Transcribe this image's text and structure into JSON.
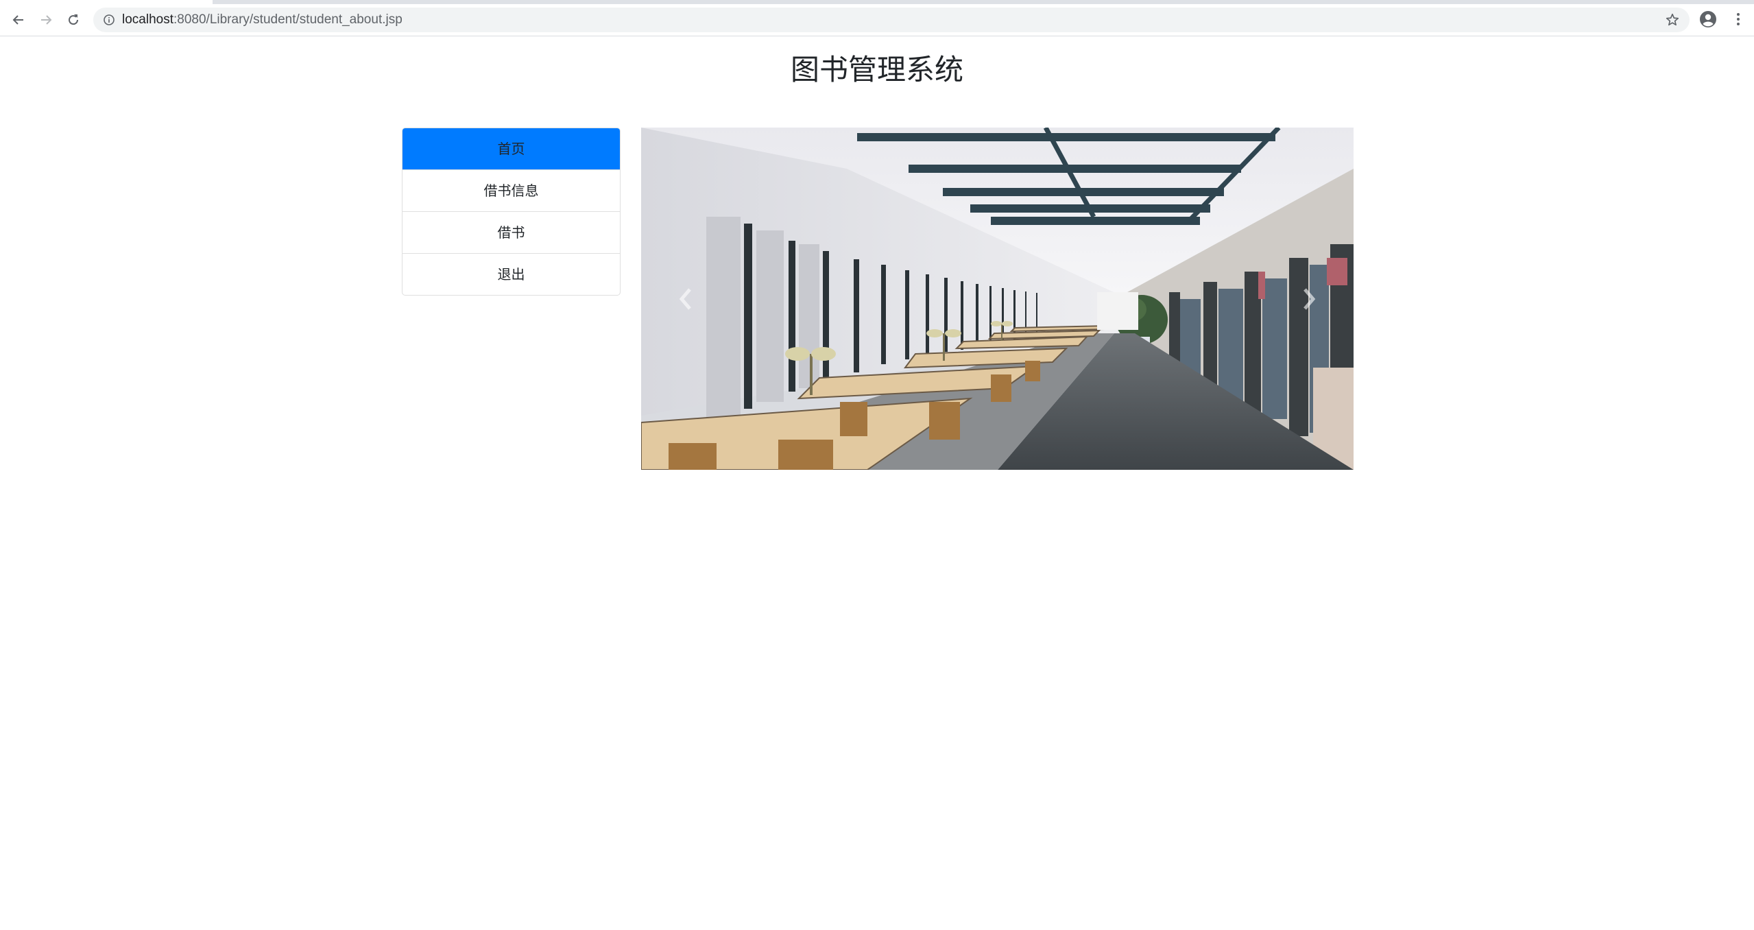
{
  "browser": {
    "url_host": "localhost",
    "url_rest": ":8080/Library/student/student_about.jsp",
    "icons": {
      "back": "back-arrow-icon",
      "forward": "forward-arrow-icon",
      "reload": "reload-icon",
      "info": "info-icon",
      "bookmark": "star-icon",
      "profile": "profile-icon",
      "menu": "kebab-menu-icon"
    }
  },
  "page": {
    "title": "图书管理系统"
  },
  "sidebar": {
    "items": [
      {
        "label": "首页",
        "active": true
      },
      {
        "label": "借书信息",
        "active": false
      },
      {
        "label": "借书",
        "active": false
      },
      {
        "label": "退出",
        "active": false
      }
    ]
  },
  "carousel": {
    "image": "library-reading-room-photo",
    "controls": {
      "prev": "chevron-left-icon",
      "next": "chevron-right-icon"
    }
  },
  "colors": {
    "accent": "#007bff",
    "border": "#dfdfdf",
    "text": "#212529"
  }
}
